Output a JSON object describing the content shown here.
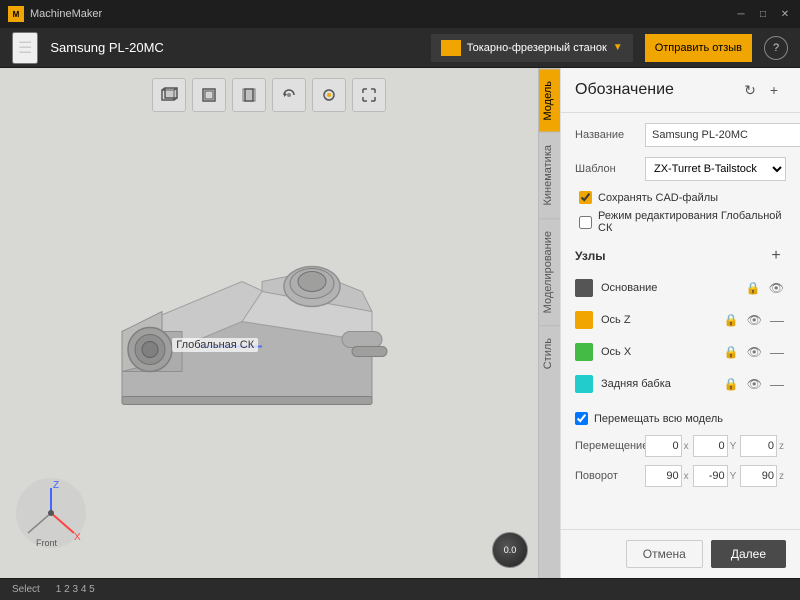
{
  "titlebar": {
    "app_name": "MachineMaker",
    "minimize_label": "─",
    "maximize_label": "□",
    "close_label": "✕"
  },
  "toolbar": {
    "machine_name": "Samsung PL-20MC",
    "machine_type": "Токарно-фрезерный станок",
    "feedback_label": "Отправить отзыв",
    "help_label": "?"
  },
  "view_tools": {
    "perspective_label": "⬛",
    "front_label": "⬜",
    "side_label": "⬜",
    "rotate_label": "↻",
    "dot_label": "●",
    "expand_label": "⤡"
  },
  "vertical_tabs": [
    {
      "id": "model",
      "label": "Модель",
      "active": true
    },
    {
      "id": "kinematics",
      "label": "Кинематика",
      "active": false
    },
    {
      "id": "modeling",
      "label": "Моделирование",
      "active": false
    },
    {
      "id": "style",
      "label": "Стиль",
      "active": false
    }
  ],
  "panel": {
    "title": "Обозначение",
    "refresh_label": "↻",
    "add_label": "+",
    "fields": {
      "name_label": "Название",
      "name_value": "Samsung PL-20MC",
      "template_label": "Шаблон",
      "template_value": "ZX-Turret B-Tailstock"
    },
    "checkboxes": {
      "save_cad_label": "Сохранять CAD-файлы",
      "save_cad_checked": true,
      "edit_global_label": "Режим редактирования Глобальной СК",
      "edit_global_checked": false
    },
    "nodes": {
      "section_title": "Узлы",
      "items": [
        {
          "name": "Основание",
          "color": "#555555",
          "locked": true,
          "visible": true,
          "removable": false
        },
        {
          "name": "Ось Z",
          "color": "#f0a500",
          "locked": true,
          "visible": true,
          "removable": true
        },
        {
          "name": "Ось X",
          "color": "#44bb44",
          "locked": true,
          "visible": true,
          "removable": true
        },
        {
          "name": "Задняя бабка",
          "color": "#22cccc",
          "locked": true,
          "visible": true,
          "removable": true
        }
      ]
    },
    "move_model": {
      "label": "Перемещать всю модель",
      "checked": true
    },
    "transform": {
      "move_label": "Перемещение",
      "move_x": "0",
      "move_y": "0",
      "move_z": "0",
      "rotate_label": "Поворот",
      "rotate_x": "90",
      "rotate_y": "-90",
      "rotate_z": "90"
    },
    "footer": {
      "cancel_label": "Отмена",
      "next_label": "Далее"
    }
  },
  "model": {
    "global_ck_label": "Глобальная СК"
  },
  "statusbar": {
    "select_label": "Select",
    "coords": "1 2 3 4 5"
  },
  "orientation": {
    "label": "0.0"
  }
}
